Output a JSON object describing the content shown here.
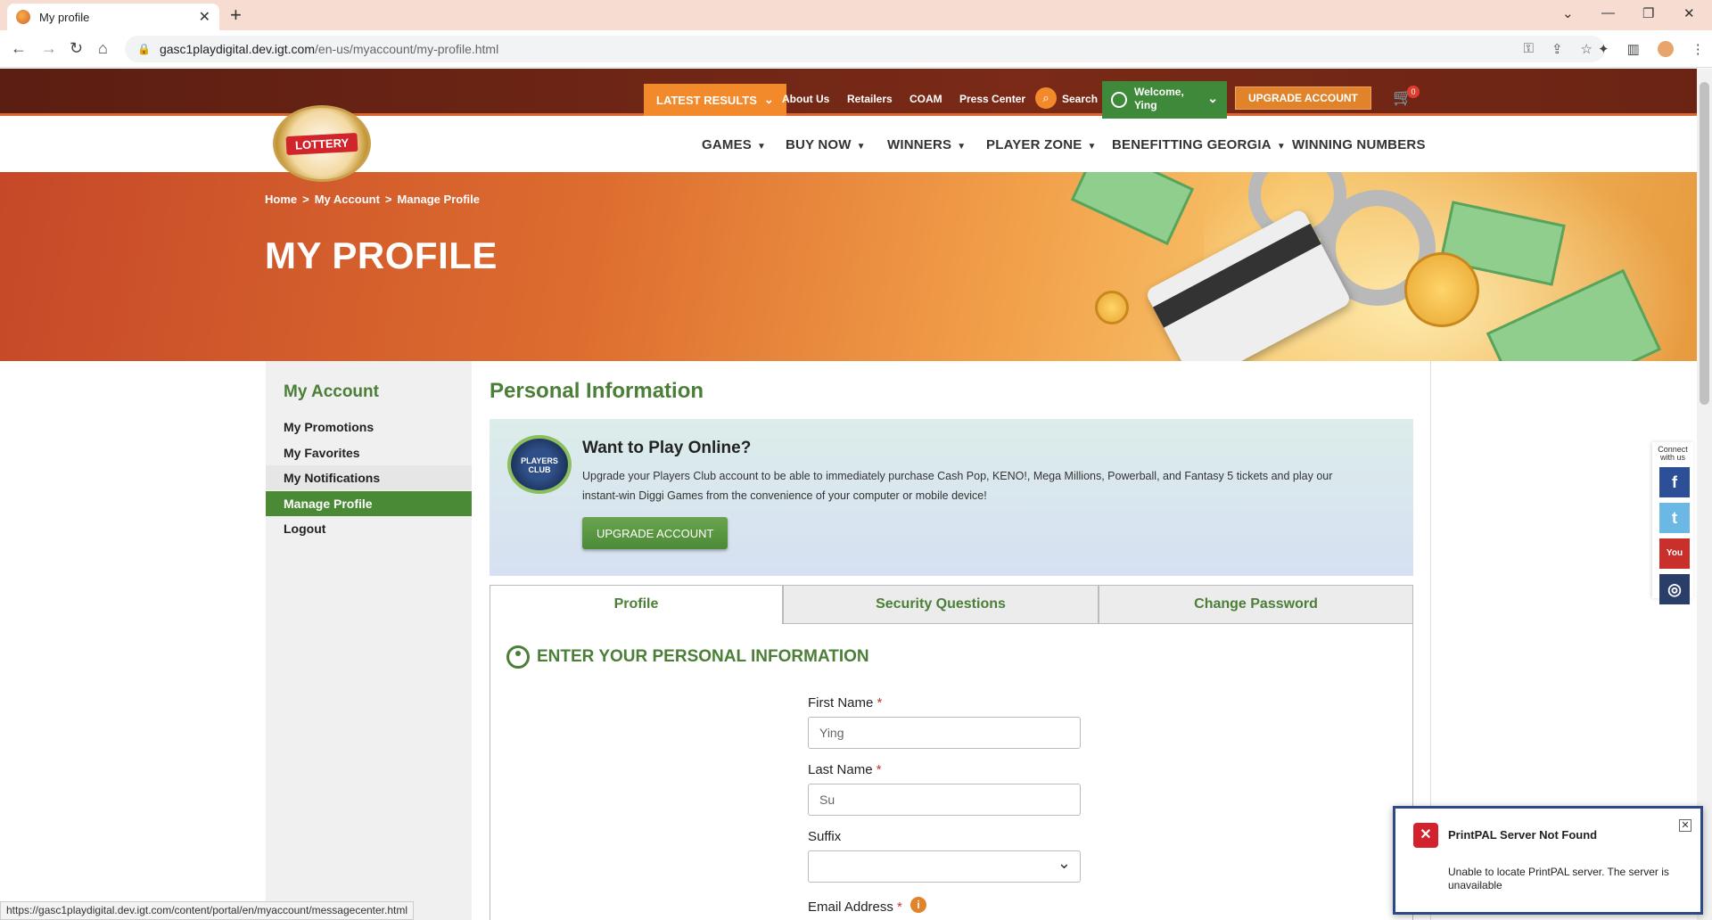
{
  "browser": {
    "tab_title": "My profile",
    "url_domain": "gasc1playdigital.dev.igt.com",
    "url_path": "/en-us/myaccount/my-profile.html"
  },
  "topbar": {
    "latest_results": "LATEST RESULTS",
    "links": [
      "About Us",
      "Retailers",
      "COAM",
      "Press Center"
    ],
    "search": "Search",
    "welcome_line1": "Welcome,",
    "welcome_name": "Ying",
    "upgrade": "UPGRADE ACCOUNT",
    "cart_count": "0"
  },
  "logo": {
    "text": "LOTTERY"
  },
  "nav": {
    "items": [
      "GAMES",
      "BUY NOW",
      "WINNERS",
      "PLAYER ZONE",
      "BENEFITTING GEORGIA",
      "WINNING NUMBERS"
    ]
  },
  "breadcrumb": [
    "Home",
    "My Account",
    "Manage Profile"
  ],
  "hero_title": "MY PROFILE",
  "sidebar": {
    "title": "My Account",
    "items": [
      "My Promotions",
      "My Favorites",
      "My Notifications",
      "Manage Profile",
      "Logout"
    ]
  },
  "main": {
    "title": "Personal Information",
    "promo": {
      "badge": "PLAYERS CLUB",
      "heading": "Want to Play Online?",
      "body": "Upgrade your Players Club account to be able to immediately purchase Cash Pop, KENO!, Mega Millions, Powerball, and Fantasy 5 tickets and play our instant-win Diggi Games from the convenience of your computer or mobile device!",
      "button": "UPGRADE ACCOUNT"
    },
    "tabs": [
      "Profile",
      "Security Questions",
      "Change Password"
    ],
    "form": {
      "heading": "ENTER YOUR PERSONAL INFORMATION",
      "first_name_label": "First Name",
      "first_name_value": "Ying",
      "last_name_label": "Last Name",
      "last_name_value": "Su",
      "suffix_label": "Suffix",
      "suffix_value": "",
      "email_label": "Email Address",
      "required_mark": "*"
    }
  },
  "social": {
    "label": "Connect with us",
    "items": [
      "facebook",
      "twitter",
      "youtube",
      "instagram"
    ]
  },
  "status_url": "https://gasc1playdigital.dev.igt.com/content/portal/en/myaccount/messagecenter.html",
  "toast": {
    "title": "PrintPAL Server Not Found",
    "message": "Unable to locate PrintPAL server. The server is unavailable"
  }
}
